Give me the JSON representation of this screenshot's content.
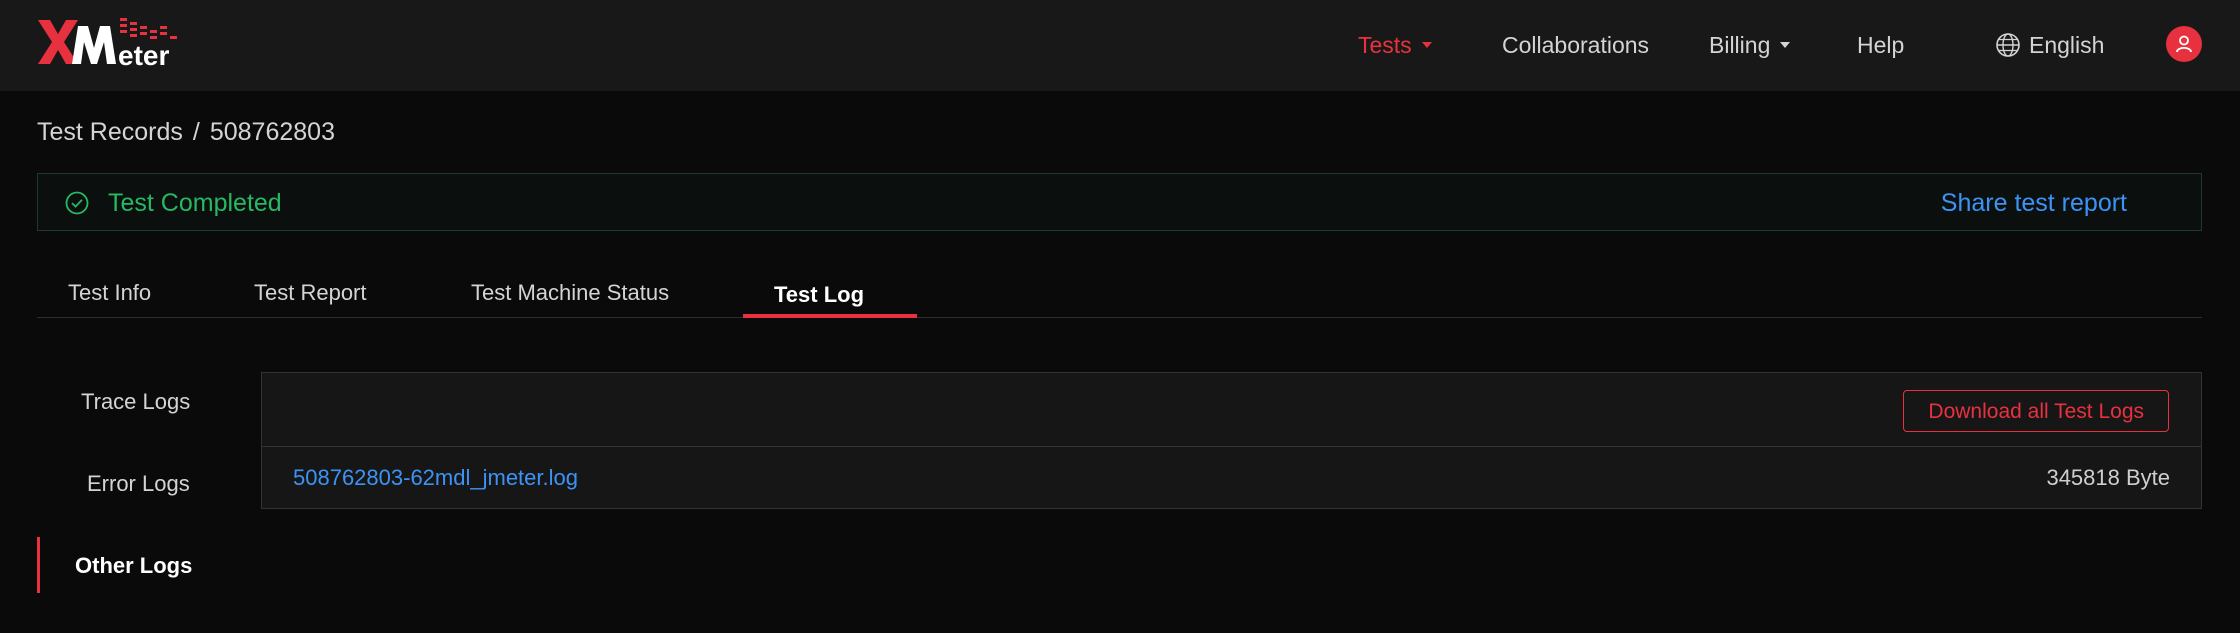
{
  "header": {
    "logo_text": "XMeter",
    "nav": {
      "tests": "Tests",
      "collaborations": "Collaborations",
      "billing": "Billing",
      "help": "Help",
      "language": "English"
    }
  },
  "breadcrumb": {
    "parent": "Test Records",
    "separator": "/",
    "current": "508762803"
  },
  "status": {
    "text": "Test Completed",
    "share_label": "Share test report"
  },
  "tabs": [
    {
      "label": "Test Info"
    },
    {
      "label": "Test Report"
    },
    {
      "label": "Test Machine Status"
    },
    {
      "label": "Test Log"
    }
  ],
  "log_menu": [
    {
      "label": "Trace Logs"
    },
    {
      "label": "Error Logs"
    },
    {
      "label": "Other Logs"
    }
  ],
  "log_panel": {
    "download_label": "Download all Test Logs",
    "files": [
      {
        "name": "508762803-62mdl_jmeter.log",
        "size": "345818 Byte"
      }
    ]
  },
  "colors": {
    "accent": "#e8313f",
    "success": "#27b765",
    "link": "#3d93f5",
    "background": "#0a0a0a"
  }
}
